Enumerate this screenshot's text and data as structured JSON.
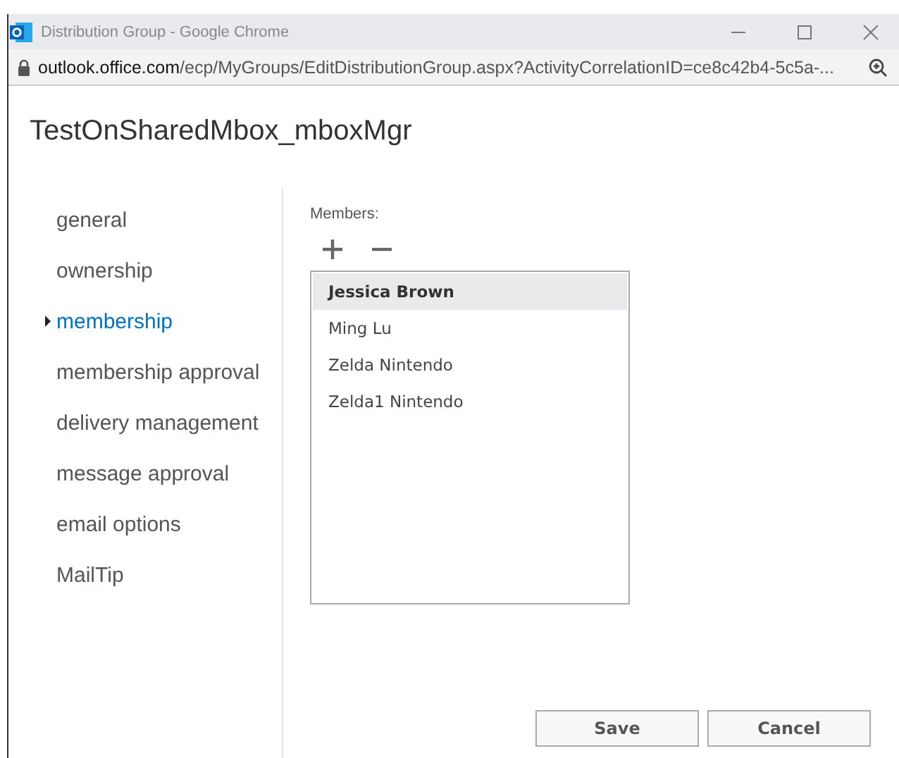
{
  "window": {
    "title": "Distribution Group - Google Chrome"
  },
  "address_bar": {
    "host": "outlook.office.com",
    "path": "/ecp/MyGroups/EditDistributionGroup.aspx?ActivityCorrelationID=ce8c42b4-5c5a-..."
  },
  "page_title": "TestOnSharedMbox_mboxMgr",
  "nav": [
    {
      "label": "general",
      "selected": false
    },
    {
      "label": "ownership",
      "selected": false
    },
    {
      "label": "membership",
      "selected": true
    },
    {
      "label": "membership approval",
      "selected": false
    },
    {
      "label": "delivery management",
      "selected": false
    },
    {
      "label": "message approval",
      "selected": false
    },
    {
      "label": "email options",
      "selected": false
    },
    {
      "label": "MailTip",
      "selected": false
    }
  ],
  "members": {
    "label": "Members:",
    "items": [
      {
        "name": "Jessica Brown",
        "selected": true
      },
      {
        "name": "Ming Lu",
        "selected": false
      },
      {
        "name": "Zelda Nintendo",
        "selected": false
      },
      {
        "name": "Zelda1 Nintendo",
        "selected": false
      }
    ]
  },
  "buttons": [
    "Save",
    "Cancel"
  ]
}
